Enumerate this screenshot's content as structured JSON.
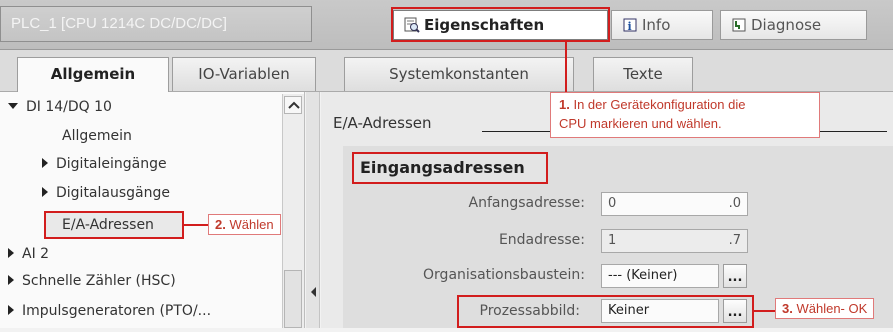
{
  "title_bar": {
    "device_title": "PLC_1 [CPU 1214C DC/DC/DC]",
    "tabs": [
      {
        "label": "Eigenschaften",
        "icon": "properties-icon"
      },
      {
        "label": "Info",
        "icon": "info-icon"
      },
      {
        "label": "Diagnose",
        "icon": "diagnostics-icon"
      }
    ]
  },
  "sub_tabs": [
    "Allgemein",
    "IO-Variablen",
    "Systemkonstanten",
    "Texte"
  ],
  "tree": {
    "items": [
      {
        "label": "DI 14/DQ 10",
        "expanded": true
      },
      {
        "label": "Allgemein"
      },
      {
        "label": "Digitaleingänge"
      },
      {
        "label": "Digitalausgänge"
      },
      {
        "label": "E/A-Adressen",
        "selected": true
      },
      {
        "label": "AI 2"
      },
      {
        "label": "Schnelle Zähler (HSC)"
      },
      {
        "label": "Impulsgeneratoren (PTO/..."
      }
    ]
  },
  "content": {
    "section_title": "E/A-Adressen",
    "group_title": "Eingangsadressen",
    "fields": {
      "start_label": "Anfangsadresse:",
      "start_value": "0",
      "start_bit": ".0",
      "end_label": "Endadresse:",
      "end_value": "1",
      "end_bit": ".7",
      "ob_label": "Organisationsbaustein:",
      "ob_value": "--- (Keiner)",
      "pi_label": "Prozessabbild:",
      "pi_value": "Keiner",
      "browse_label": "..."
    }
  },
  "callouts": {
    "c1_num": "1.",
    "c1_text_a": "In der Gerätekonfiguration die",
    "c1_text_b": "CPU markieren und wählen.",
    "c2_num": "2.",
    "c2_text": "Wählen",
    "c3_num": "3.",
    "c3_text": "Wählen- OK"
  },
  "colors": {
    "highlight": "#d21d1d"
  }
}
